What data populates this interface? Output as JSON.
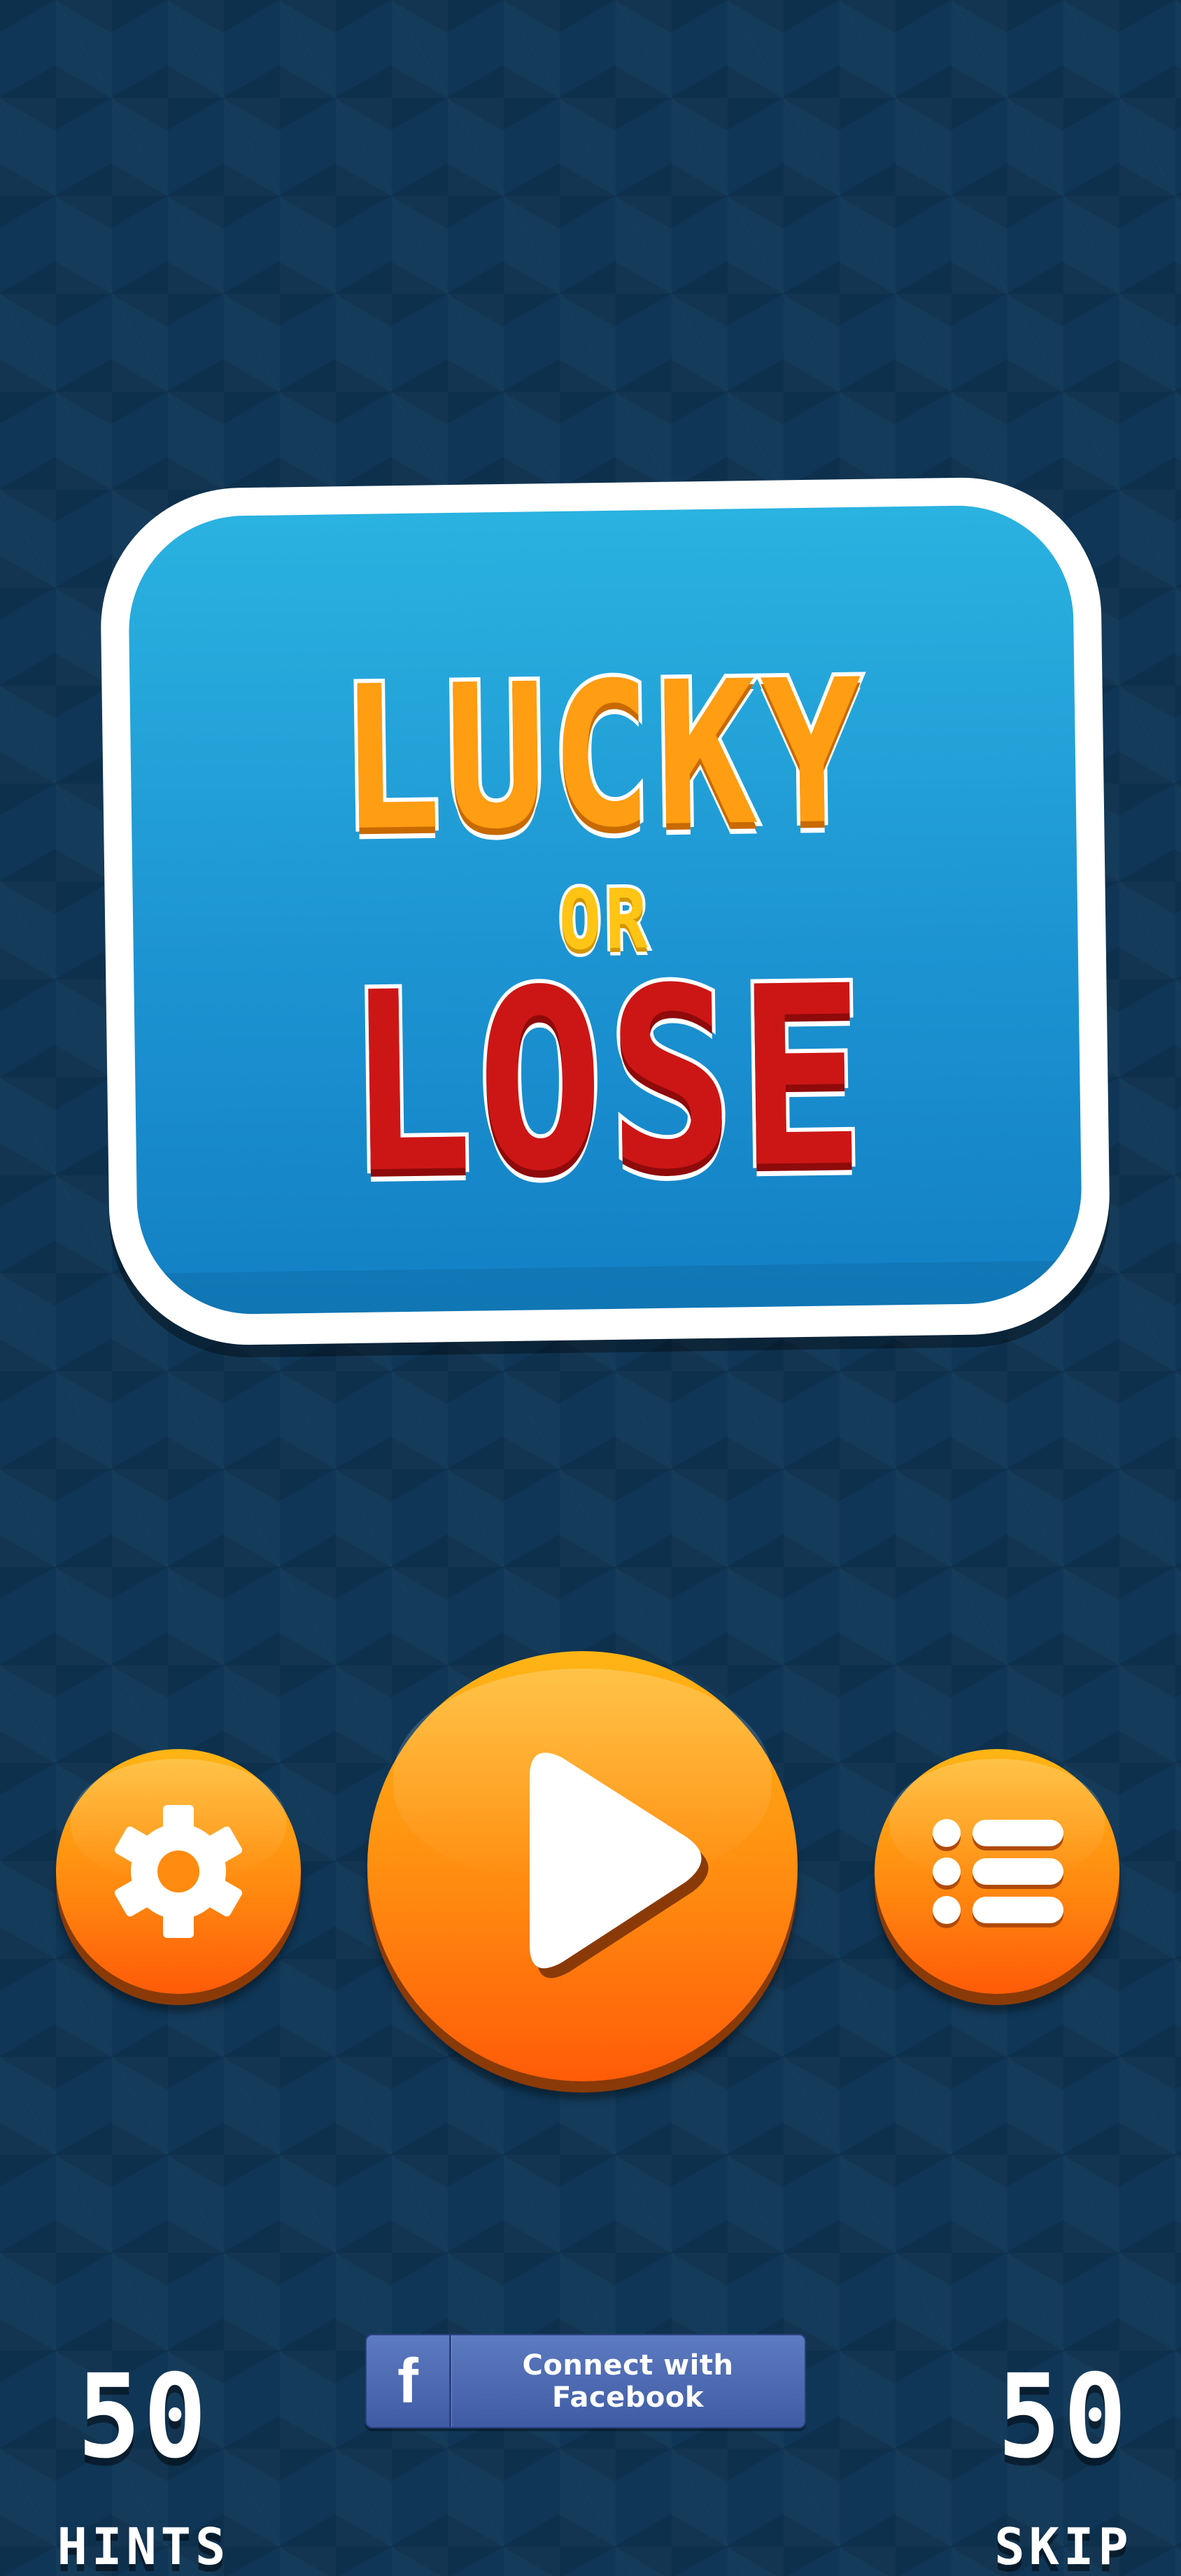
{
  "logo": {
    "line1": "LUCKY",
    "line2": "OR",
    "line3": "LOSE"
  },
  "buttons": {
    "settings_icon": "gear-icon",
    "play_icon": "play-icon",
    "menu_icon": "list-icon"
  },
  "hints": {
    "value": "50",
    "label": "HINTS"
  },
  "skip": {
    "value": "50",
    "label": "SKIP"
  },
  "facebook": {
    "icon": "f",
    "label": "Connect with Facebook"
  },
  "colors": {
    "background": "#0f3656",
    "panel_blue": "#1d94d2",
    "lucky_orange": "#ff9d13",
    "or_yellow": "#ffc414",
    "lose_red": "#cc1616",
    "button_orange": "#ff8b10",
    "facebook_blue": "#3f5ba4"
  }
}
